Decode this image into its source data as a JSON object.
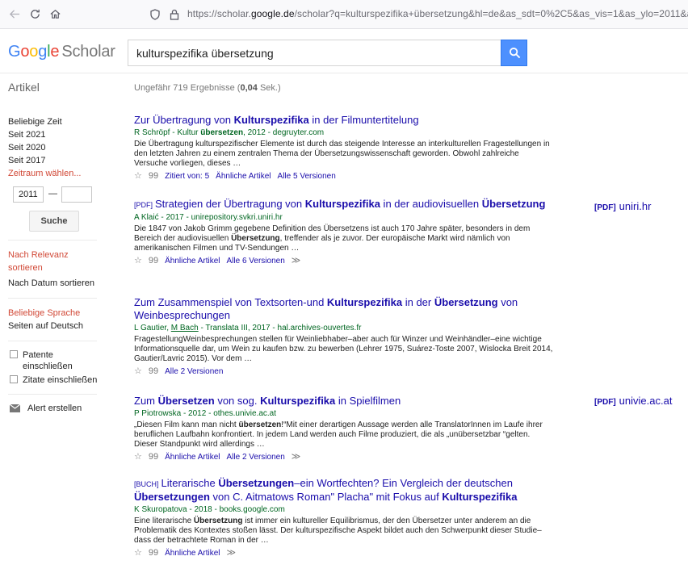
{
  "browser": {
    "url_prefix": "https://scholar.",
    "url_domain": "google.de",
    "url_rest": "/scholar?q=kulturspezifika+übersetzung&hl=de&as_sdt=0%2C5&as_vis=1&as_ylo=2011&as_yh"
  },
  "header": {
    "logo_google": [
      "G",
      "o",
      "o",
      "g",
      "l",
      "e"
    ],
    "logo_scholar": "Scholar",
    "search_value": "kulturspezifika übersetzung"
  },
  "subheader": {
    "section": "Artikel",
    "count_prefix": "Ungefähr 719 Ergebnisse (",
    "count_time": "0,04",
    "count_suffix": " Sek.)"
  },
  "sidebar": {
    "time_filters": [
      "Beliebige Zeit",
      "Seit 2021",
      "Seit 2020",
      "Seit 2017"
    ],
    "custom_range": "Zeitraum wählen...",
    "year_from": "2011",
    "year_dash": "—",
    "search_button": "Suche",
    "sort_relevance": "Nach Relevanz sortieren",
    "sort_date": "Nach Datum sortieren",
    "lang_any": "Beliebige Sprache",
    "lang_de": "Seiten auf Deutsch",
    "include_patents": "Patente einschließen",
    "include_citations": "Zitate einschließen",
    "create_alert": "Alert erstellen"
  },
  "results": [
    {
      "tag": "",
      "title_html": "Zur Übertragung von <b>Kulturspezifika</b> in der Filmuntertitelung",
      "meta_html": "R Schröpf - Kultur <b>übersetzen</b>, 2012 - degruyter.com",
      "snippet_html": "Die Übertragung kulturspezifischer Elemente ist durch das steigende Interesse an interkulturellen Fragestellungen in den letzten Jahren zu einem zentralen Thema der Übersetzungswissenschaft geworden. Obwohl zahlreiche Versuche vorliegen, dieses …",
      "actions": [
        "Zitiert von: 5",
        "Ähnliche Artikel",
        "Alle 5 Versionen"
      ],
      "side_tag": "",
      "side_domain": ""
    },
    {
      "tag": "[PDF]",
      "title_html": "Strategien der Übertragung von <b>Kulturspezifika</b> in der audiovisuellen <b>Übersetzung</b>",
      "meta_html": "A Klaić - 2017 - unirepository.svkri.uniri.hr",
      "snippet_html": "Die 1847 von Jakob Grimm gegebene Definition des Übersetzens ist auch 170 Jahre später, besonders in dem Bereich der audiovisuellen <b>Übersetzung</b>, treffender als je zuvor. Der europäische Markt wird nämlich von amerikanischen Filmen und TV-Sendungen …",
      "actions": [
        "Ähnliche Artikel",
        "Alle 6 Versionen"
      ],
      "side_tag": "[PDF]",
      "side_domain": "uniri.hr"
    },
    {
      "tag": "",
      "title_html": "Zum Zusammenspiel von Textsorten-und <b>Kulturspezifika</b> in der <b>Übersetzung</b> von Weinbesprechungen",
      "meta_html": "L Gautier, <u>M Bach</u> - Translata III, 2017 - hal.archives-ouvertes.fr",
      "snippet_html": "FragestellungWeinbesprechungen stellen für Weinliebhaber–aber auch für Winzer und Weinhändler–eine wichtige Informationsquelle dar, um Wein zu kaufen bzw. zu bewerben (Lehrer 1975, Suárez-Toste 2007, Wislocka Breit 2014, Gautier/Lavric 2015). Vor dem …",
      "actions": [
        "Alle 2 Versionen"
      ],
      "side_tag": "",
      "side_domain": ""
    },
    {
      "tag": "",
      "title_html": "Zum <b>Übersetzen</b> von sog. <b>Kulturspezifika</b> in Spielfilmen",
      "meta_html": "P Piotrowska - 2012 - othes.univie.ac.at",
      "snippet_html": "„Diesen Film kann man nicht <b>übersetzen</b>!“Mit einer derartigen Aussage werden alle TranslatorInnen im Laufe ihrer beruflichen Laufbahn konfrontiert. In jedem Land werden auch Filme produziert, die als „unübersetzbar “gelten. Dieser Standpunkt wird allerdings …",
      "actions": [
        "Ähnliche Artikel",
        "Alle 2 Versionen"
      ],
      "side_tag": "[PDF]",
      "side_domain": "univie.ac.at"
    },
    {
      "tag": "[BUCH]",
      "title_html": "Literarische <b>Übersetzungen</b>–ein Wortfechten? Ein Vergleich der deutschen <b>Übersetzungen</b> von C. Aitmatows Roman\" Placha\" mit Fokus auf <b>Kulturspezifika</b>",
      "meta_html": "K Skuropatova - 2018 - books.google.com",
      "snippet_html": "Eine literarische <b>Übersetzung</b> ist immer ein kultureller Equilibrismus, der den Übersetzer unter anderem an die Problematik des Kontextes stoßen lässt. Der kulturspezifische Aspekt bildet auch den Schwerpunkt dieser Studie–dass der betrachtete Roman in der …",
      "actions": [
        "Ähnliche Artikel"
      ],
      "side_tag": "",
      "side_domain": ""
    }
  ],
  "icons": {
    "save": "☆",
    "cite": "99",
    "more": "≫"
  }
}
